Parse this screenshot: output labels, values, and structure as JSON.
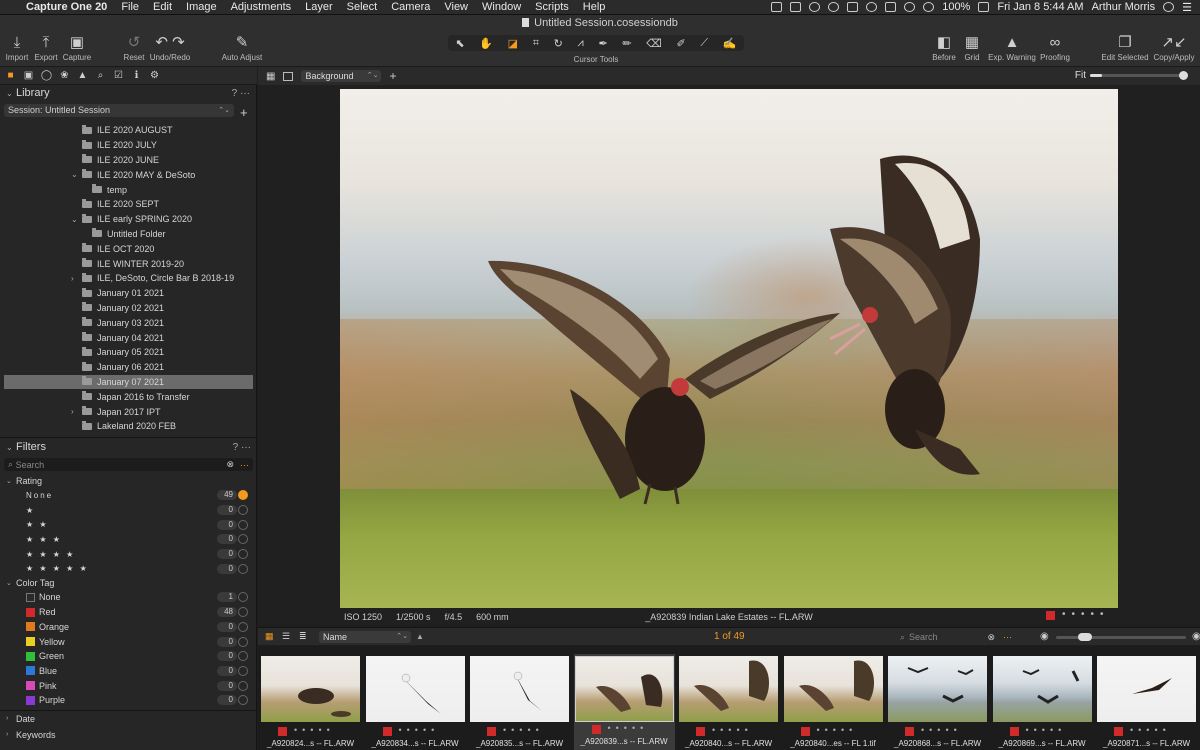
{
  "menubar": {
    "app_name": "Capture One 20",
    "items": [
      "File",
      "Edit",
      "Image",
      "Adjustments",
      "Layer",
      "Select",
      "Camera",
      "View",
      "Window",
      "Scripts",
      "Help"
    ],
    "battery": "100%",
    "datetime": "Fri Jan 8  5:44 AM",
    "user": "Arthur Morris"
  },
  "window": {
    "title": "Untitled Session.cosessiondb"
  },
  "toolbar": {
    "import": "Import",
    "export": "Export",
    "capture": "Capture",
    "reset": "Reset",
    "undo_redo": "Undo/Redo",
    "auto_adjust": "Auto Adjust",
    "cursor_tools": "Cursor Tools",
    "before": "Before",
    "grid": "Grid",
    "exp_warning": "Exp. Warning",
    "proofing": "Proofing",
    "edit_selected": "Edit Selected",
    "copy_apply": "Copy/Apply"
  },
  "library": {
    "title": "Library",
    "session": "Session: Untitled Session",
    "folders": [
      {
        "label": "ILE 2020 AUGUST",
        "indent": 0,
        "arrow": ""
      },
      {
        "label": "ILE 2020 JULY",
        "indent": 0,
        "arrow": ""
      },
      {
        "label": "ILE 2020 JUNE",
        "indent": 0,
        "arrow": ""
      },
      {
        "label": "ILE 2020 MAY & DeSoto",
        "indent": 0,
        "arrow": "open"
      },
      {
        "label": "temp",
        "indent": 1,
        "arrow": ""
      },
      {
        "label": "ILE 2020 SEPT",
        "indent": 0,
        "arrow": ""
      },
      {
        "label": "ILE early SPRING 2020",
        "indent": 0,
        "arrow": "open"
      },
      {
        "label": "Untitled Folder",
        "indent": 1,
        "arrow": ""
      },
      {
        "label": "ILE OCT 2020",
        "indent": 0,
        "arrow": ""
      },
      {
        "label": "ILE WINTER 2019-20",
        "indent": 0,
        "arrow": ""
      },
      {
        "label": "ILE, DeSoto, Circle Bar B 2018-19",
        "indent": 0,
        "arrow": "closed"
      },
      {
        "label": "January 01 2021",
        "indent": 0,
        "arrow": ""
      },
      {
        "label": "January 02 2021",
        "indent": 0,
        "arrow": ""
      },
      {
        "label": "January 03 2021",
        "indent": 0,
        "arrow": ""
      },
      {
        "label": "January 04 2021",
        "indent": 0,
        "arrow": ""
      },
      {
        "label": "January 05 2021",
        "indent": 0,
        "arrow": ""
      },
      {
        "label": "January 06 2021",
        "indent": 0,
        "arrow": ""
      },
      {
        "label": "January 07 2021",
        "indent": 0,
        "arrow": "",
        "selected": true
      },
      {
        "label": "Japan 2016 to Transfer",
        "indent": 0,
        "arrow": ""
      },
      {
        "label": "Japan 2017 IPT",
        "indent": 0,
        "arrow": "closed"
      },
      {
        "label": "Lakeland 2020 FEB",
        "indent": 0,
        "arrow": ""
      }
    ]
  },
  "filters": {
    "title": "Filters",
    "search_placeholder": "Search",
    "rating_label": "Rating",
    "ratings": [
      {
        "label": "None",
        "count": "49",
        "active": true
      },
      {
        "label": "★",
        "count": "0"
      },
      {
        "label": "★ ★",
        "count": "0"
      },
      {
        "label": "★ ★ ★",
        "count": "0"
      },
      {
        "label": "★ ★ ★ ★",
        "count": "0"
      },
      {
        "label": "★ ★ ★ ★ ★",
        "count": "0"
      }
    ],
    "color_tag_label": "Color Tag",
    "color_tags": [
      {
        "label": "None",
        "count": "1",
        "color": "#2a2a2a"
      },
      {
        "label": "Red",
        "count": "48",
        "color": "#d12a2a"
      },
      {
        "label": "Orange",
        "count": "0",
        "color": "#e07a1f"
      },
      {
        "label": "Yellow",
        "count": "0",
        "color": "#e8d020"
      },
      {
        "label": "Green",
        "count": "0",
        "color": "#2fbf3a"
      },
      {
        "label": "Blue",
        "count": "0",
        "color": "#2a78d8"
      },
      {
        "label": "Pink",
        "count": "0",
        "color": "#d84ab8"
      },
      {
        "label": "Purple",
        "count": "0",
        "color": "#8a3ad0"
      }
    ],
    "date_label": "Date",
    "keywords_label": "Keywords"
  },
  "viewer": {
    "background": "Background",
    "fit": "Fit",
    "iso": "ISO 1250",
    "shutter": "1/2500 s",
    "aperture": "f/4.5",
    "focal": "600 mm",
    "filename": "_A920839  Indian Lake Estates -- FL.ARW"
  },
  "browser": {
    "sort": "Name",
    "count": "1 of 49",
    "search_placeholder": "Search",
    "thumbs": [
      {
        "name": "_A920824...s -- FL.ARW",
        "scene": "field"
      },
      {
        "name": "_A920834...s -- FL.ARW",
        "scene": "white"
      },
      {
        "name": "_A920835...s -- FL.ARW",
        "scene": "white"
      },
      {
        "name": "_A920839...s -- FL.ARW",
        "scene": "field",
        "selected": true
      },
      {
        "name": "_A920840...s -- FL.ARW",
        "scene": "field"
      },
      {
        "name": "_A920840...es -- FL 1.tif",
        "scene": "field"
      },
      {
        "name": "_A920868...s -- FL.ARW",
        "scene": "water"
      },
      {
        "name": "_A920869...s -- FL.ARW",
        "scene": "water"
      },
      {
        "name": "_A920871...s -- FL.ARW",
        "scene": "white"
      }
    ]
  },
  "colors": {
    "accent": "#f39a1f",
    "tag_red": "#d12a2a"
  }
}
